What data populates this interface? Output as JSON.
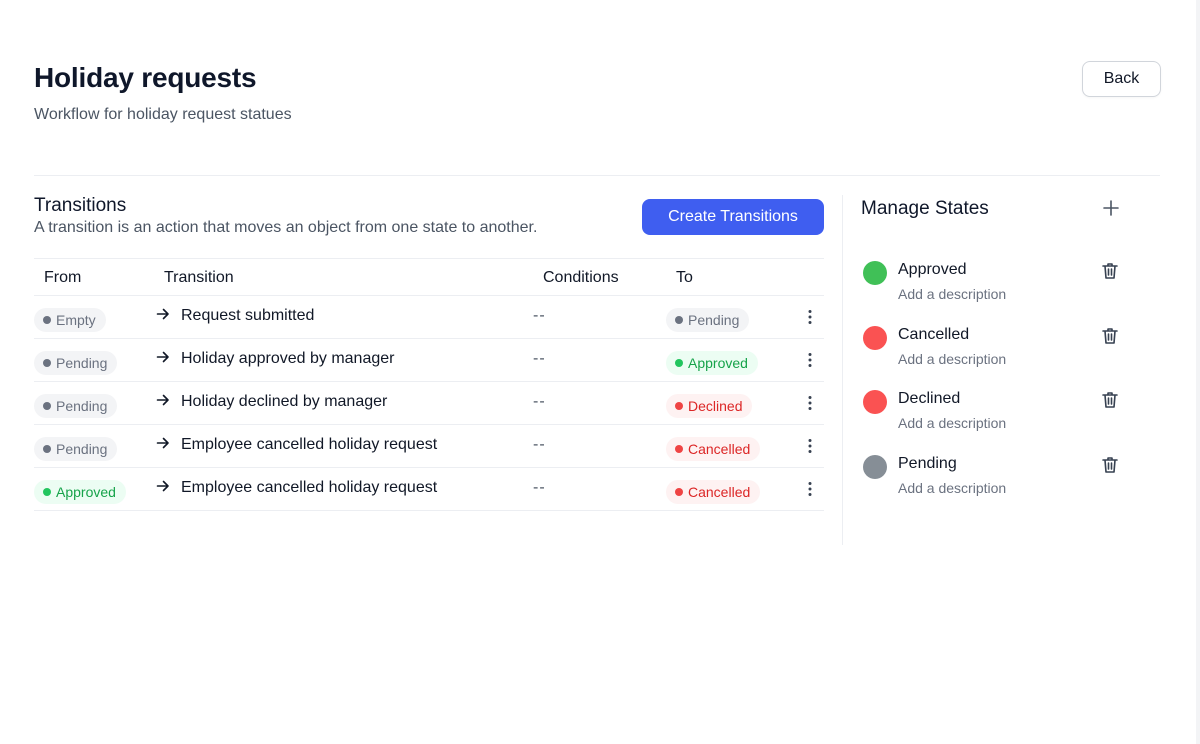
{
  "header": {
    "title": "Holiday requests",
    "subtitle": "Workflow for holiday request statues",
    "back_label": "Back"
  },
  "transitions": {
    "title": "Transitions",
    "description": "A transition is an action that moves an object from one state to another.",
    "create_label": "Create Transitions",
    "columns": [
      "From",
      "Transition",
      "Conditions",
      "To"
    ],
    "rows": [
      {
        "from": "Empty",
        "from_color": "grey",
        "transition": "Request submitted",
        "conditions": "--",
        "to": "Pending",
        "to_color": "grey"
      },
      {
        "from": "Pending",
        "from_color": "grey",
        "transition": "Holiday approved by manager",
        "conditions": "--",
        "to": "Approved",
        "to_color": "green"
      },
      {
        "from": "Pending",
        "from_color": "grey",
        "transition": "Holiday declined by manager",
        "conditions": "--",
        "to": "Declined",
        "to_color": "red"
      },
      {
        "from": "Pending",
        "from_color": "grey",
        "transition": "Employee cancelled holiday request",
        "conditions": "--",
        "to": "Cancelled",
        "to_color": "red"
      },
      {
        "from": "Approved",
        "from_color": "green",
        "transition": "Employee cancelled holiday request",
        "conditions": "--",
        "to": "Cancelled",
        "to_color": "red"
      }
    ]
  },
  "states": {
    "title": "Manage States",
    "items": [
      {
        "name": "Approved",
        "description": "Add a description",
        "color": "#40c057"
      },
      {
        "name": "Cancelled",
        "description": "Add a description",
        "color": "#fa5252"
      },
      {
        "name": "Declined",
        "description": "Add a description",
        "color": "#fa5252"
      },
      {
        "name": "Pending",
        "description": "Add a description",
        "color": "#868e96"
      }
    ]
  },
  "icons": {
    "plus": "plus-icon",
    "trash": "trash-icon",
    "arrow": "arrow-right-icon",
    "more": "kebab-menu-icon"
  }
}
